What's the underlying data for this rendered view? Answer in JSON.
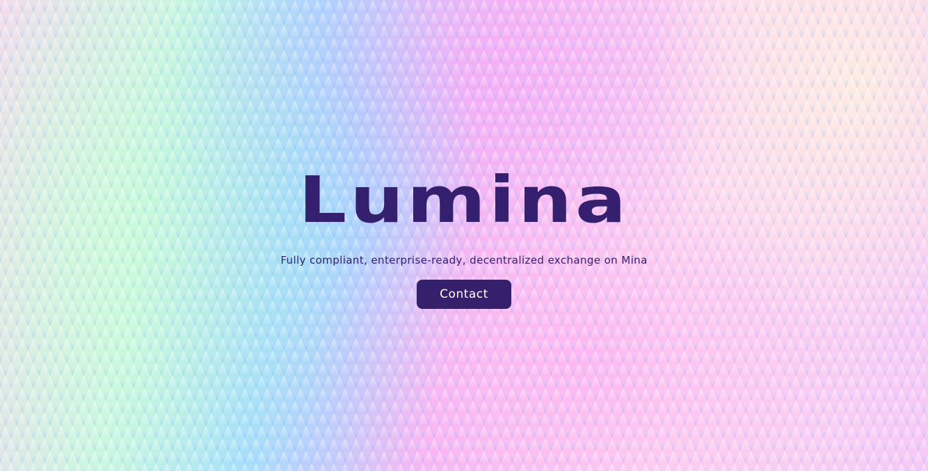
{
  "hero": {
    "logo_text": "Lumina",
    "tagline": "Fully compliant, enterprise-ready, decentralized exchange on Mina",
    "contact_label": "Contact"
  },
  "colors": {
    "brand": "#35206f",
    "button_bg": "#34206b",
    "button_text": "#ffffff"
  }
}
